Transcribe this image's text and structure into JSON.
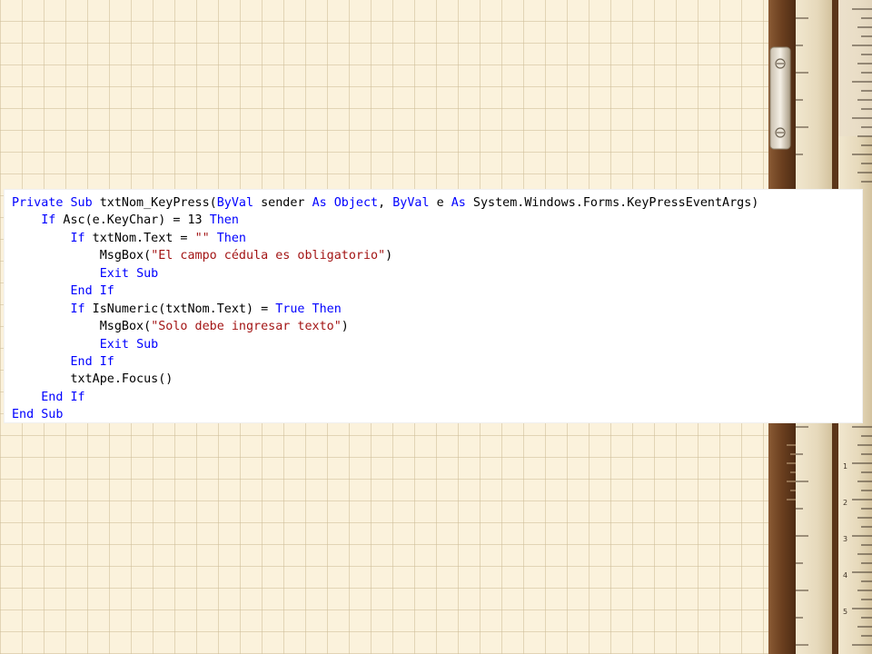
{
  "theme": {
    "background": "#fbf2dc",
    "grid_line": "#cdbc96",
    "code_panel_bg": "#ffffff",
    "keyword_color": "#0000ff",
    "string_color": "#a31515",
    "text_color": "#000000",
    "ruler_wood_dark": "#6b3f1f",
    "ruler_wood_light": "#e8dcc0"
  },
  "code": {
    "language": "VB.NET",
    "lines": [
      [
        {
          "t": "kw",
          "v": "Private"
        },
        {
          "t": "plain",
          "v": " "
        },
        {
          "t": "kw",
          "v": "Sub"
        },
        {
          "t": "plain",
          "v": " txtNom_KeyPress("
        },
        {
          "t": "kw",
          "v": "ByVal"
        },
        {
          "t": "plain",
          "v": " sender "
        },
        {
          "t": "kw",
          "v": "As"
        },
        {
          "t": "plain",
          "v": " "
        },
        {
          "t": "kw",
          "v": "Object"
        },
        {
          "t": "plain",
          "v": ", "
        },
        {
          "t": "kw",
          "v": "ByVal"
        },
        {
          "t": "plain",
          "v": " e "
        },
        {
          "t": "kw",
          "v": "As"
        },
        {
          "t": "plain",
          "v": " System.Windows.Forms.KeyPressEventArgs)"
        }
      ],
      [
        {
          "t": "plain",
          "v": "    "
        },
        {
          "t": "kw",
          "v": "If"
        },
        {
          "t": "plain",
          "v": " Asc(e.KeyChar) = 13 "
        },
        {
          "t": "kw",
          "v": "Then"
        }
      ],
      [
        {
          "t": "plain",
          "v": "        "
        },
        {
          "t": "kw",
          "v": "If"
        },
        {
          "t": "plain",
          "v": " txtNom.Text = "
        },
        {
          "t": "str",
          "v": "\"\""
        },
        {
          "t": "plain",
          "v": " "
        },
        {
          "t": "kw",
          "v": "Then"
        }
      ],
      [
        {
          "t": "plain",
          "v": "            MsgBox("
        },
        {
          "t": "str",
          "v": "\"El campo cédula es obligatorio\""
        },
        {
          "t": "plain",
          "v": ")"
        }
      ],
      [
        {
          "t": "plain",
          "v": "            "
        },
        {
          "t": "kw",
          "v": "Exit"
        },
        {
          "t": "plain",
          "v": " "
        },
        {
          "t": "kw",
          "v": "Sub"
        }
      ],
      [
        {
          "t": "plain",
          "v": "        "
        },
        {
          "t": "kw",
          "v": "End"
        },
        {
          "t": "plain",
          "v": " "
        },
        {
          "t": "kw",
          "v": "If"
        }
      ],
      [
        {
          "t": "plain",
          "v": "        "
        },
        {
          "t": "kw",
          "v": "If"
        },
        {
          "t": "plain",
          "v": " IsNumeric(txtNom.Text) = "
        },
        {
          "t": "kw",
          "v": "True"
        },
        {
          "t": "plain",
          "v": " "
        },
        {
          "t": "kw",
          "v": "Then"
        }
      ],
      [
        {
          "t": "plain",
          "v": "            MsgBox("
        },
        {
          "t": "str",
          "v": "\"Solo debe ingresar texto\""
        },
        {
          "t": "plain",
          "v": ")"
        }
      ],
      [
        {
          "t": "plain",
          "v": "            "
        },
        {
          "t": "kw",
          "v": "Exit"
        },
        {
          "t": "plain",
          "v": " "
        },
        {
          "t": "kw",
          "v": "Sub"
        }
      ],
      [
        {
          "t": "plain",
          "v": "        "
        },
        {
          "t": "kw",
          "v": "End"
        },
        {
          "t": "plain",
          "v": " "
        },
        {
          "t": "kw",
          "v": "If"
        }
      ],
      [
        {
          "t": "plain",
          "v": "        txtApe.Focus()"
        }
      ],
      [
        {
          "t": "plain",
          "v": "    "
        },
        {
          "t": "kw",
          "v": "End"
        },
        {
          "t": "plain",
          "v": " "
        },
        {
          "t": "kw",
          "v": "If"
        }
      ],
      [
        {
          "t": "kw",
          "v": "End"
        },
        {
          "t": "plain",
          "v": " "
        },
        {
          "t": "kw",
          "v": "Sub"
        }
      ]
    ]
  }
}
